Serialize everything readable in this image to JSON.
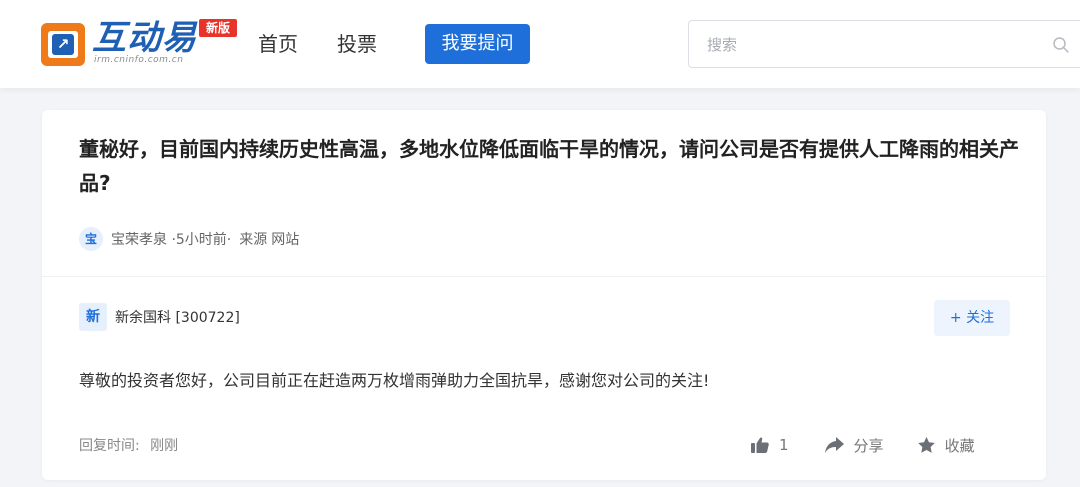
{
  "header": {
    "logo": {
      "mark": "↗",
      "title": "互动易",
      "badge": "新版",
      "url": "irm.cninfo.com.cn"
    },
    "nav": {
      "home": "首页",
      "vote": "投票"
    },
    "ask_button": "我要提问",
    "search": {
      "placeholder": "搜索",
      "value": ""
    }
  },
  "question": {
    "text": "董秘好，目前国内持续历史性高温，多地水位降低面临干旱的情况，请问公司是否有提供人工降雨的相关产品?",
    "author_avatar": "宝",
    "author": "宝荣孝泉",
    "time": " ·5小时前·",
    "source_label": "来源",
    "source": "网站"
  },
  "answer": {
    "company_avatar": "新",
    "company": "新余国科 [300722]",
    "follow_button": "+ 关注",
    "text": "尊敬的投资者您好，公司目前正在赶造两万枚增雨弹助力全国抗旱，感谢您对公司的关注!",
    "reply_time_label": "回复时间:",
    "reply_time": "刚刚"
  },
  "actions": {
    "like_count": "1",
    "share": "分享",
    "collect": "收藏"
  },
  "colors": {
    "brand_blue": "#1e6fd9",
    "logo_orange": "#ef7a1a",
    "badge_red": "#e8332a",
    "page_bg": "#f3f4f7"
  },
  "icons": {
    "like": "thumbs-up-icon",
    "share": "share-arrow-icon",
    "collect": "star-icon",
    "search": "search-icon"
  }
}
